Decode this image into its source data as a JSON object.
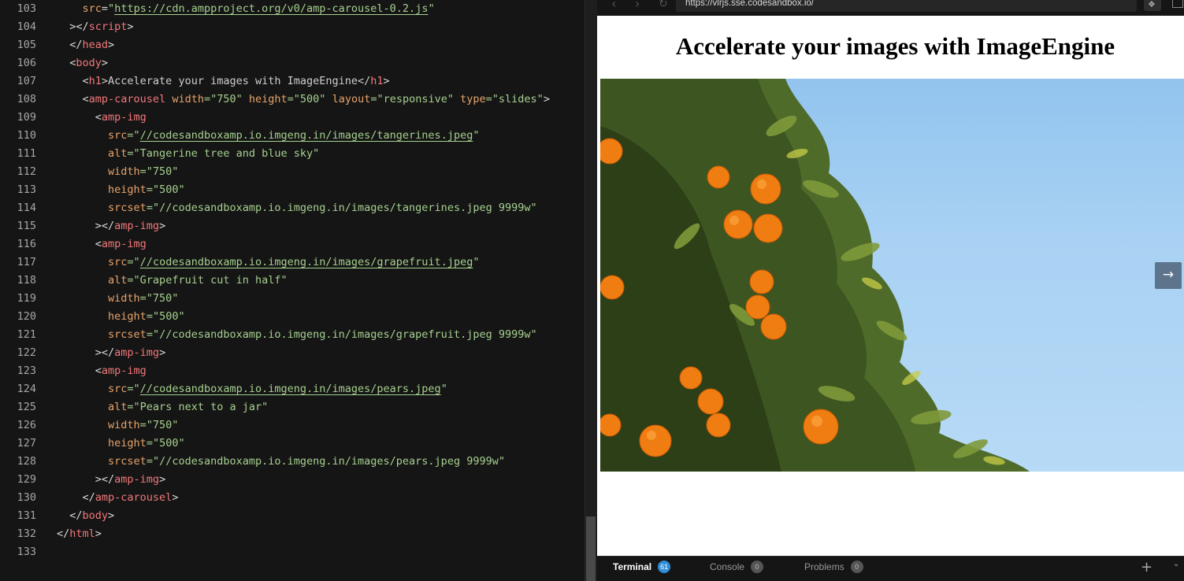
{
  "editor": {
    "lines": [
      {
        "n": "103",
        "tokens": [
          [
            "    ",
            ""
          ],
          [
            "src",
            "t-attr"
          ],
          [
            "=",
            "t-punc"
          ],
          [
            "\"",
            "t-str"
          ],
          [
            "https://cdn.ampproject.org/v0/amp-carousel-0.2.js",
            "t-url"
          ],
          [
            "\"",
            "t-str"
          ]
        ]
      },
      {
        "n": "104",
        "tokens": [
          [
            "  ></",
            "t-punc"
          ],
          [
            "script",
            "t-tag"
          ],
          [
            ">",
            "t-punc"
          ]
        ]
      },
      {
        "n": "105",
        "tokens": [
          [
            "  </",
            "t-punc"
          ],
          [
            "head",
            "t-tag"
          ],
          [
            ">",
            "t-punc"
          ]
        ]
      },
      {
        "n": "106",
        "tokens": [
          [
            "  <",
            "t-punc"
          ],
          [
            "body",
            "t-tag"
          ],
          [
            ">",
            "t-punc"
          ]
        ]
      },
      {
        "n": "107",
        "tokens": [
          [
            "    <",
            "t-punc"
          ],
          [
            "h1",
            "t-tag"
          ],
          [
            ">Accelerate your images with ImageEngine</",
            "t-text"
          ],
          [
            "h1",
            "t-tag"
          ],
          [
            ">",
            "t-punc"
          ]
        ]
      },
      {
        "n": "108",
        "tokens": [
          [
            "    <",
            "t-punc"
          ],
          [
            "amp-carousel",
            "t-tag"
          ],
          [
            " ",
            ""
          ],
          [
            "width",
            "t-attr"
          ],
          [
            "=\"750\" ",
            "t-str"
          ],
          [
            "height",
            "t-attr"
          ],
          [
            "=\"500\" ",
            "t-str"
          ],
          [
            "layout",
            "t-attr"
          ],
          [
            "=\"responsive\" ",
            "t-str"
          ],
          [
            "type",
            "t-attr"
          ],
          [
            "=\"slides\"",
            "t-str"
          ],
          [
            ">",
            "t-punc"
          ]
        ]
      },
      {
        "n": "109",
        "tokens": [
          [
            "      <",
            "t-punc"
          ],
          [
            "amp-img",
            "t-tag"
          ]
        ]
      },
      {
        "n": "110",
        "tokens": [
          [
            "        ",
            ""
          ],
          [
            "src",
            "t-attr"
          ],
          [
            "=\"",
            "t-str"
          ],
          [
            "//codesandboxamp.io.imgeng.in/images/tangerines.jpeg",
            "t-url"
          ],
          [
            "\"",
            "t-str"
          ]
        ]
      },
      {
        "n": "111",
        "tokens": [
          [
            "        ",
            ""
          ],
          [
            "alt",
            "t-attr"
          ],
          [
            "=\"Tangerine tree and blue sky\"",
            "t-str"
          ]
        ]
      },
      {
        "n": "112",
        "tokens": [
          [
            "        ",
            ""
          ],
          [
            "width",
            "t-attr"
          ],
          [
            "=\"750\"",
            "t-str"
          ]
        ]
      },
      {
        "n": "113",
        "tokens": [
          [
            "        ",
            ""
          ],
          [
            "height",
            "t-attr"
          ],
          [
            "=\"500\"",
            "t-str"
          ]
        ]
      },
      {
        "n": "114",
        "tokens": [
          [
            "        ",
            ""
          ],
          [
            "srcset",
            "t-attr"
          ],
          [
            "=\"//codesandboxamp.io.imgeng.in/images/tangerines.jpeg 9999w\"",
            "t-str"
          ]
        ]
      },
      {
        "n": "115",
        "tokens": [
          [
            "      ></",
            "t-punc"
          ],
          [
            "amp-img",
            "t-tag"
          ],
          [
            ">",
            "t-punc"
          ]
        ]
      },
      {
        "n": "116",
        "tokens": [
          [
            "      <",
            "t-punc"
          ],
          [
            "amp-img",
            "t-tag"
          ]
        ]
      },
      {
        "n": "117",
        "tokens": [
          [
            "        ",
            ""
          ],
          [
            "src",
            "t-attr"
          ],
          [
            "=\"",
            "t-str"
          ],
          [
            "//codesandboxamp.io.imgeng.in/images/grapefruit.jpeg",
            "t-url"
          ],
          [
            "\"",
            "t-str"
          ]
        ]
      },
      {
        "n": "118",
        "tokens": [
          [
            "        ",
            ""
          ],
          [
            "alt",
            "t-attr"
          ],
          [
            "=\"Grapefruit cut in half\"",
            "t-str"
          ]
        ]
      },
      {
        "n": "119",
        "tokens": [
          [
            "        ",
            ""
          ],
          [
            "width",
            "t-attr"
          ],
          [
            "=\"750\"",
            "t-str"
          ]
        ]
      },
      {
        "n": "120",
        "tokens": [
          [
            "        ",
            ""
          ],
          [
            "height",
            "t-attr"
          ],
          [
            "=\"500\"",
            "t-str"
          ]
        ]
      },
      {
        "n": "121",
        "tokens": [
          [
            "        ",
            ""
          ],
          [
            "srcset",
            "t-attr"
          ],
          [
            "=\"//codesandboxamp.io.imgeng.in/images/grapefruit.jpeg 9999w\"",
            "t-str"
          ]
        ]
      },
      {
        "n": "122",
        "tokens": [
          [
            "      ></",
            "t-punc"
          ],
          [
            "amp-img",
            "t-tag"
          ],
          [
            ">",
            "t-punc"
          ]
        ]
      },
      {
        "n": "123",
        "tokens": [
          [
            "      <",
            "t-punc"
          ],
          [
            "amp-img",
            "t-tag"
          ]
        ]
      },
      {
        "n": "124",
        "tokens": [
          [
            "        ",
            ""
          ],
          [
            "src",
            "t-attr"
          ],
          [
            "=\"",
            "t-str"
          ],
          [
            "//codesandboxamp.io.imgeng.in/images/pears.jpeg",
            "t-url"
          ],
          [
            "\"",
            "t-str"
          ]
        ]
      },
      {
        "n": "125",
        "tokens": [
          [
            "        ",
            ""
          ],
          [
            "alt",
            "t-attr"
          ],
          [
            "=\"Pears next to a jar\"",
            "t-str"
          ]
        ]
      },
      {
        "n": "126",
        "tokens": [
          [
            "        ",
            ""
          ],
          [
            "width",
            "t-attr"
          ],
          [
            "=\"750\"",
            "t-str"
          ]
        ]
      },
      {
        "n": "127",
        "tokens": [
          [
            "        ",
            ""
          ],
          [
            "height",
            "t-attr"
          ],
          [
            "=\"500\"",
            "t-str"
          ]
        ]
      },
      {
        "n": "128",
        "tokens": [
          [
            "        ",
            ""
          ],
          [
            "srcset",
            "t-attr"
          ],
          [
            "=\"//codesandboxamp.io.imgeng.in/images/pears.jpeg 9999w\"",
            "t-str"
          ]
        ]
      },
      {
        "n": "129",
        "tokens": [
          [
            "      ></",
            "t-punc"
          ],
          [
            "amp-img",
            "t-tag"
          ],
          [
            ">",
            "t-punc"
          ]
        ]
      },
      {
        "n": "130",
        "tokens": [
          [
            "    </",
            "t-punc"
          ],
          [
            "amp-carousel",
            "t-tag"
          ],
          [
            ">",
            "t-punc"
          ]
        ]
      },
      {
        "n": "131",
        "tokens": [
          [
            "  </",
            "t-punc"
          ],
          [
            "body",
            "t-tag"
          ],
          [
            ">",
            "t-punc"
          ]
        ]
      },
      {
        "n": "132",
        "tokens": [
          [
            "</",
            "t-punc"
          ],
          [
            "html",
            "t-tag"
          ],
          [
            ">",
            "t-punc"
          ]
        ]
      },
      {
        "n": "133",
        "tokens": []
      }
    ]
  },
  "preview": {
    "url": "https://vlrjs.sse.codesandbox.io/",
    "back_icon": "‹",
    "forward_icon": "›",
    "reload_icon": "↻",
    "extension_icon": "❖",
    "heading": "Accelerate your images with ImageEngine",
    "image_alt": "Tangerine tree and blue sky",
    "next_icon": "→"
  },
  "panel": {
    "tabs": [
      {
        "label": "Terminal",
        "count": "61",
        "active": true,
        "badge": "blue"
      },
      {
        "label": "Console",
        "count": "0",
        "active": false,
        "badge": "gray"
      },
      {
        "label": "Problems",
        "count": "0",
        "active": false,
        "badge": "gray"
      }
    ],
    "add_icon": "+",
    "collapse_icon": "⌄"
  },
  "colors": {
    "editor_bg": "#151515",
    "tag": "#f2777a",
    "attr": "#e8a36a",
    "string": "#a6d08f",
    "line_number": "#a6a6a6",
    "badge_blue": "#2f8dd8",
    "sky": "#a8d1f3"
  }
}
